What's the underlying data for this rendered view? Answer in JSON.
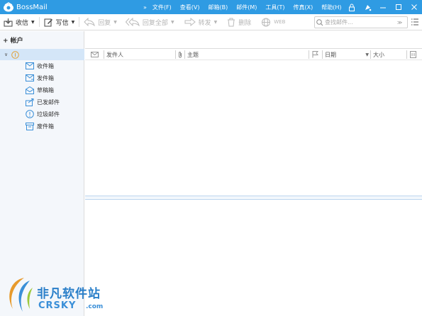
{
  "app": {
    "title": "BossMail"
  },
  "menu": {
    "chevron": "»",
    "items": [
      "文件(F)",
      "查看(V)",
      "邮箱(B)",
      "邮件(M)",
      "工具(T)",
      "传真(X)",
      "帮助(H)"
    ]
  },
  "toolbar": {
    "receive": "收信",
    "compose": "写信",
    "reply": "回复",
    "reply_all": "回复全部",
    "forward": "转发",
    "delete": "删除",
    "web": "WEB"
  },
  "search": {
    "placeholder": "查找邮件..."
  },
  "sidebar": {
    "accounts": "+ 帐户",
    "folders": [
      {
        "label": "收件箱",
        "icon": "inbox-icon"
      },
      {
        "label": "发件箱",
        "icon": "outbox-icon"
      },
      {
        "label": "草稿箱",
        "icon": "drafts-icon"
      },
      {
        "label": "已发邮件",
        "icon": "sent-icon"
      },
      {
        "label": "垃圾邮件",
        "icon": "spam-icon"
      },
      {
        "label": "废件箱",
        "icon": "trash-icon"
      }
    ]
  },
  "columns": {
    "sender": "发件人",
    "subject": "主题",
    "date": "日期",
    "size": "大小"
  },
  "watermark": {
    "line1": "非凡软件站",
    "line2": "CRSKY",
    "line3": ".com"
  },
  "colors": {
    "titlebar": "#2f9be3",
    "selection": "#d4e6f8",
    "sidebar": "#f4f7fb"
  }
}
